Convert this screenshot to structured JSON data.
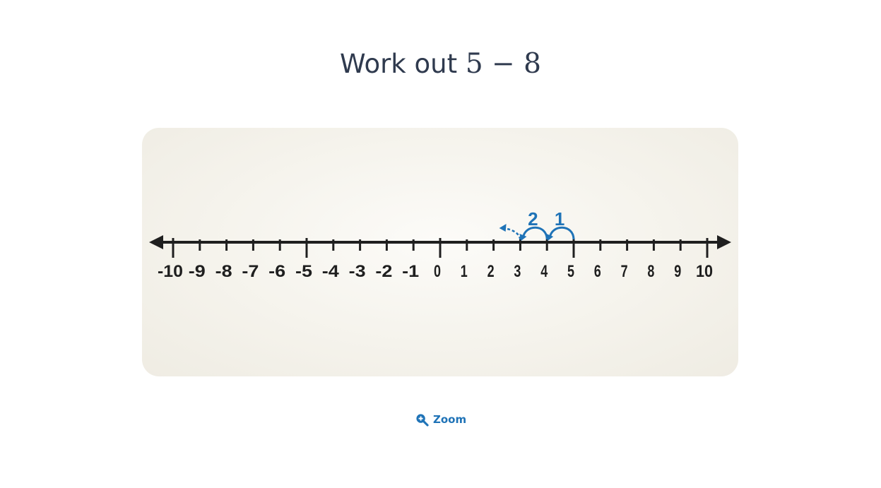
{
  "question": {
    "prefix": "Work out ",
    "expression": "5 − 8"
  },
  "number_line": {
    "min": -10,
    "max": 10,
    "tick_labels": [
      "-10",
      "-9",
      "-8",
      "-7",
      "-6",
      "-5",
      "-4",
      "-3",
      "-2",
      "-1",
      "0",
      "1",
      "2",
      "3",
      "4",
      "5",
      "6",
      "7",
      "8",
      "9",
      "10"
    ],
    "start_value": 5,
    "jumps": [
      {
        "label": "1",
        "from": 5,
        "to": 4
      },
      {
        "label": "2",
        "from": 4,
        "to": 3
      }
    ],
    "continuation_toward": 2,
    "accent_color": "#1f73b7",
    "axis_color": "#1f1f1f"
  },
  "zoom": {
    "label": "Zoom",
    "icon": "zoom-in-icon"
  }
}
